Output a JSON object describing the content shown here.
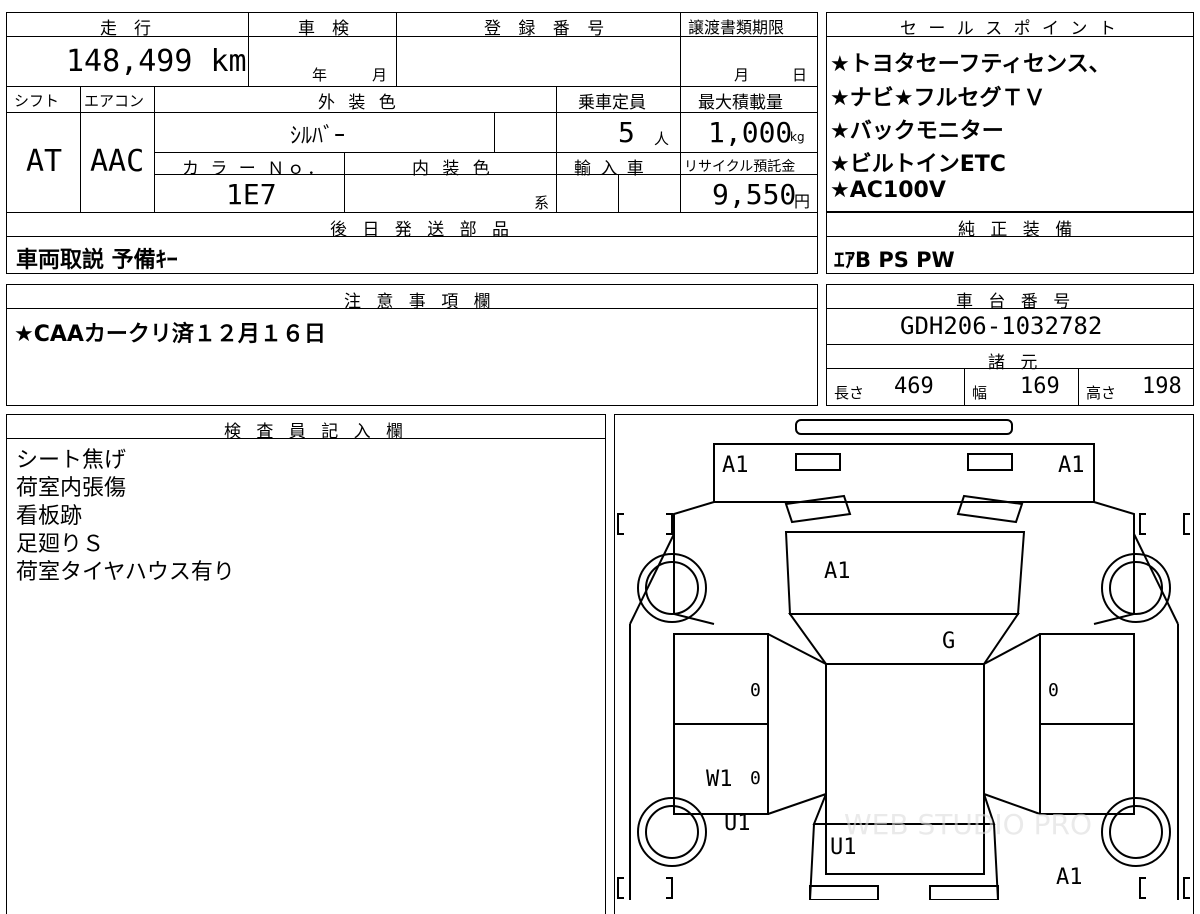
{
  "vehicle": {
    "mileage_label": "走　行",
    "mileage": "148,499 km",
    "inspection_label": "車　検",
    "inspection_year_unit": "年",
    "inspection_month_unit": "月",
    "registration_label": "登 録 番 号",
    "transfer_deadline_label": "譲渡書類期限",
    "transfer_month_unit": "月",
    "transfer_day_unit": "日",
    "shift_label": "シフト",
    "aircon_label": "エアコン",
    "exterior_color_label": "外 装 色",
    "capacity_label": "乗車定員",
    "max_load_label": "最大積載量",
    "shift": "AT",
    "aircon": "AAC",
    "exterior_color": "ｼﾙﾊﾞｰ",
    "capacity": "5",
    "capacity_unit": "人",
    "max_load": "1,000",
    "max_load_unit": "kg",
    "color_no_label": "カ ラ ー Ｎｏ．",
    "interior_color_label": "内 装 色",
    "import_label": "輸 入 車",
    "recycle_label": "リサイクル預託金",
    "color_no": "1E7",
    "interior_color_unit": "系",
    "recycle_fee": "9,550",
    "recycle_unit": "円",
    "later_parts_label": "後 日 発 送 部 品",
    "later_parts": "車両取説 予備ｷｰ"
  },
  "sales_points": {
    "label": "セ ー ル ス ポ イ ン ト",
    "items": [
      "★トヨタセーフティセンス、",
      "★ナビ★フルセグＴＶ",
      "★バックモニター",
      "★ビルトインETC",
      "★AC100V"
    ]
  },
  "genuine_equipment": {
    "label": "純 正 装 備",
    "value": "ｴｱB PS PW"
  },
  "notes": {
    "label": "注 意 事 項 欄",
    "value": "★CAAカークリ済１２月１６日"
  },
  "chassis": {
    "label": "車 台 番 号",
    "value": "GDH206-1032782"
  },
  "specs": {
    "label": "諸 元",
    "length_label": "長さ",
    "length": "469",
    "width_label": "幅",
    "width": "169",
    "height_label": "高さ",
    "height": "198"
  },
  "inspector": {
    "label": "検 査 員 記 入 欄",
    "lines": [
      "シート焦げ",
      "荷室内張傷",
      "看板跡",
      "足廻りＳ",
      "荷室タイヤハウス有り"
    ]
  },
  "diagram": {
    "marks": {
      "front_left": "A1",
      "front_right": "A1",
      "hood": "A1",
      "windshield": "G",
      "left_front_door": "0",
      "right_front_door": "0",
      "left_rear_door": "0",
      "left_rear_w": "W1",
      "left_rear_u": "U1",
      "rear_center": "U1",
      "rear_right": "A1"
    },
    "watermark": "WEB STUDIO PRO"
  }
}
